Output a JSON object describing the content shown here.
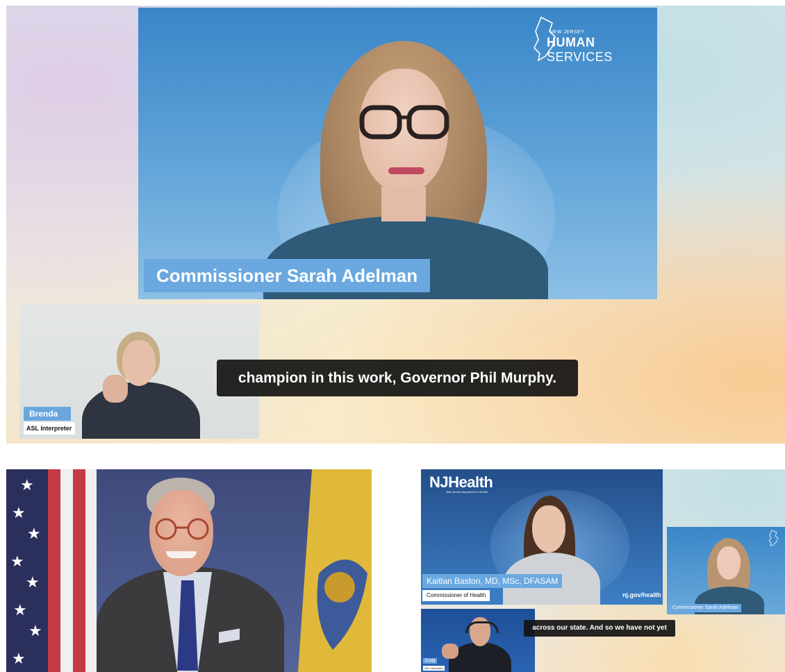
{
  "main": {
    "speaker_name": "Commissioner Sarah Adelman",
    "logo_small": "NEW JERSEY",
    "logo_bold": "HUMAN",
    "logo_rest": " SERVICES",
    "interpreter_name": "Brenda",
    "interpreter_role": "ASL Interpreter",
    "caption": "champion in this work, Governor Phil Murphy."
  },
  "health": {
    "logo": "NJHealth",
    "logo_sub": "New Jersey Department of Health",
    "speaker_name": "Kaitlan Baston, MD, MSc, DFASAM",
    "speaker_title": "Commissioner of Health",
    "url": "nj.gov/health",
    "small_tile_name": "Commissioner Sarah Adelman",
    "interpreter_name": "Craig",
    "interpreter_role": "ASL Interpreter",
    "caption": "across our state. And so we have not yet"
  },
  "colors": {
    "nameplate_blue": "#6ba8e0",
    "caption_bg": "#141414",
    "tile_blue": "#3a86c8"
  }
}
